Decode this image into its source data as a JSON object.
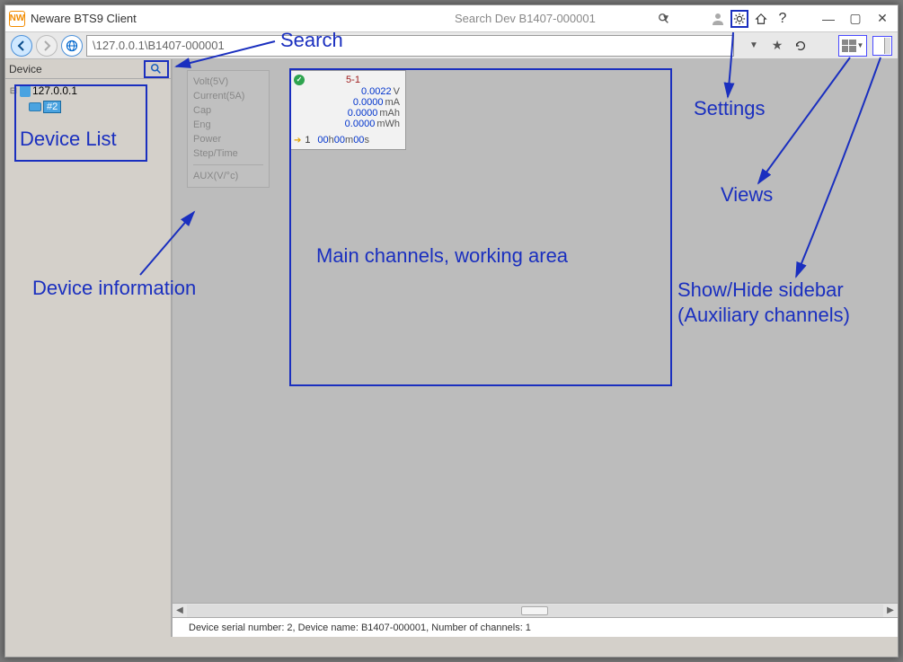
{
  "titlebar": {
    "app_name": "Neware BTS9 Client",
    "search_placeholder": "Search Dev B1407-000001"
  },
  "toolbar": {
    "address": "\\127.0.0.1\\B1407-000001"
  },
  "device_panel": {
    "header": "Device",
    "tree": {
      "root_ip": "127.0.0.1",
      "child_badge": "#2"
    }
  },
  "device_info": {
    "rows": [
      "Volt(5V)",
      "Current(5A)",
      "Cap",
      "Eng",
      "Power",
      "Step/Time"
    ],
    "aux": "AUX(V/°c)"
  },
  "channel": {
    "id": "5-1",
    "values": [
      {
        "num": "0.0022",
        "unit": "V"
      },
      {
        "num": "0.0000",
        "unit": "mA"
      },
      {
        "num": "0.0000",
        "unit": "mAh"
      },
      {
        "num": "0.0000",
        "unit": "mWh"
      }
    ],
    "step": "1",
    "time": {
      "h": "00",
      "m": "00",
      "s": "00"
    }
  },
  "statusbar": {
    "text": "Device serial number: 2, Device name: B1407-000001, Number of channels: 1"
  },
  "annotations": {
    "search": "Search",
    "settings": "Settings",
    "views": "Views",
    "sidebar": "Show/Hide sidebar",
    "sidebar2": "(Auxiliary channels)",
    "device_list": "Device List",
    "device_info": "Device information",
    "main_area": "Main channels, working area"
  }
}
